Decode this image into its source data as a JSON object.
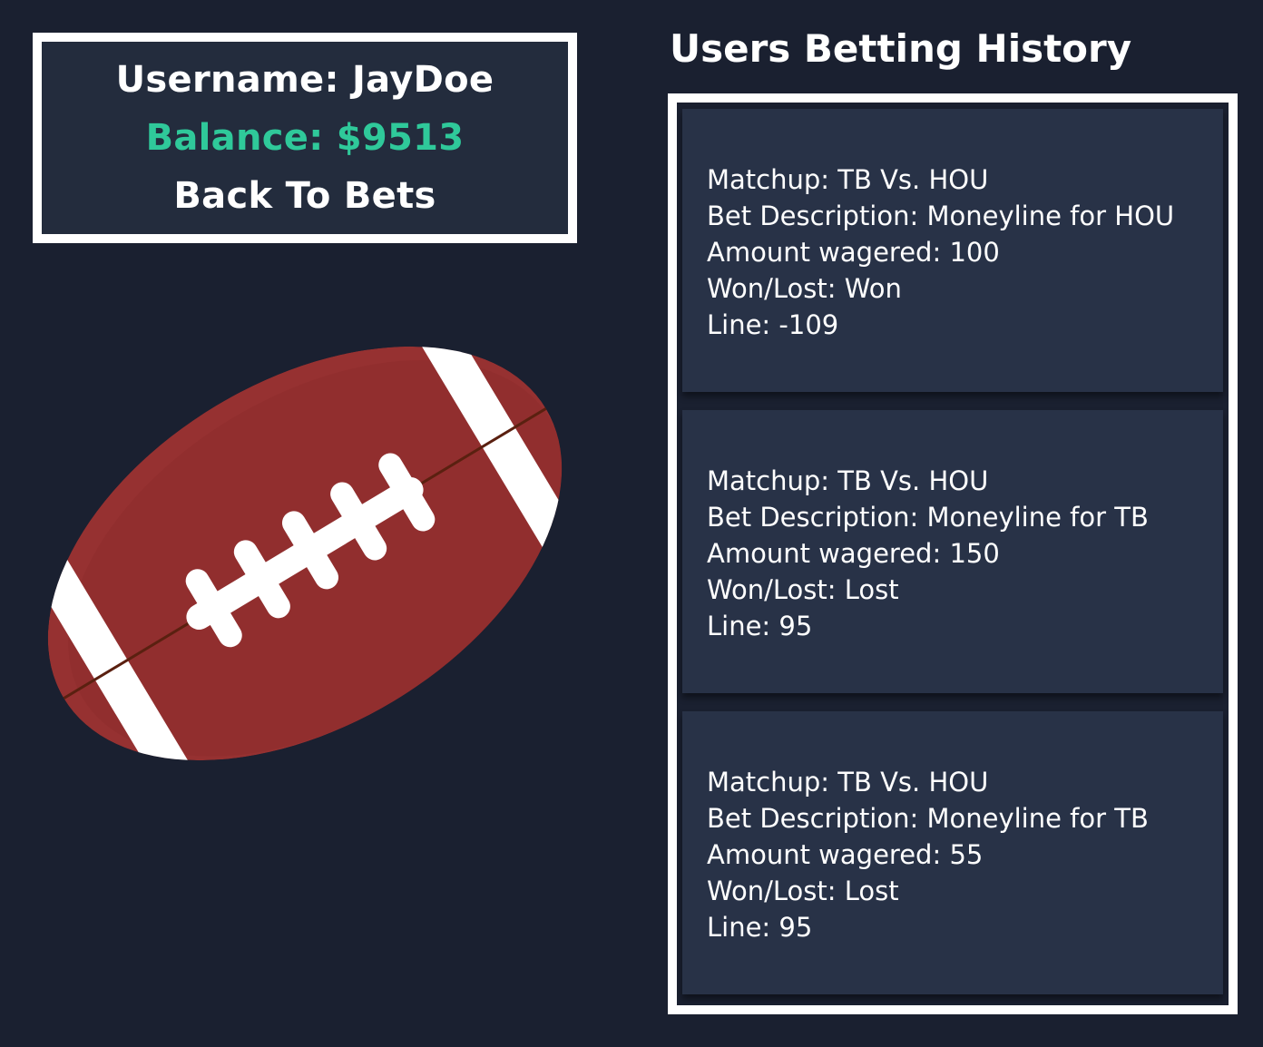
{
  "user": {
    "username_text": "Username: JayDoe",
    "balance_text": "Balance: $9513",
    "back_link": "Back To Bets"
  },
  "history": {
    "title": "Users Betting History",
    "bets": [
      {
        "matchup": "Matchup: TB Vs. HOU",
        "description": "Bet Description: Moneyline for HOU",
        "amount": "Amount wagered: 100",
        "result": "Won/Lost: Won",
        "line": "Line: -109"
      },
      {
        "matchup": "Matchup: TB Vs. HOU",
        "description": "Bet Description: Moneyline for TB",
        "amount": "Amount wagered: 150",
        "result": "Won/Lost: Lost",
        "line": "Line: 95"
      },
      {
        "matchup": "Matchup: TB Vs. HOU",
        "description": "Bet Description: Moneyline for TB",
        "amount": "Amount wagered: 55",
        "result": "Won/Lost: Lost",
        "line": "Line: 95"
      }
    ]
  },
  "image": {
    "icon": "football-icon"
  },
  "colors": {
    "background": "#1a2030",
    "panel": "#232c3d",
    "card": "#283247",
    "accent_balance": "#2fc99a",
    "football": "#963131"
  }
}
